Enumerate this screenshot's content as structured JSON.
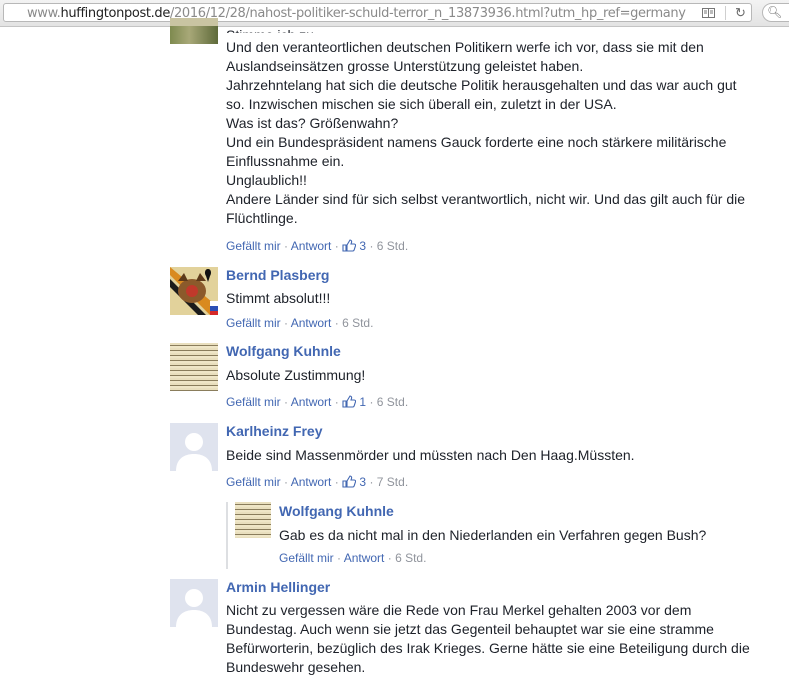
{
  "browser": {
    "url_prefix": "www.",
    "url_host": "huffingtonpost.de",
    "url_path": "/2016/12/28/nahost-politiker-schuld-terror_n_13873936.html?utm_hp_ref=germany",
    "icons": {
      "reader": "reader-view-icon",
      "reload": "reload-icon",
      "search": "search-icon"
    }
  },
  "comments": [
    {
      "id": "c1",
      "lines": [
        "Stimme ich zu.",
        "Und den veranteortlichen deutschen Politikern werfe ich vor, dass sie mit den",
        "Auslandseinsätzen grosse Unterstützung geleistet haben.",
        "Jahrzehntelang hat sich die deutsche Politik herausgehalten und das war auch gut",
        "so. Inzwischen mischen sie sich überall ein, zuletzt in der USA.",
        "Was ist das? Größenwahn?",
        "Und ein Bundespräsident namens Gauck forderte eine noch stärkere militärische",
        "Einflussnahme ein.",
        "Unglaublich!!",
        "Andere Länder sind für sich selbst verantwortlich, nicht wir. Und das gilt auch für die",
        "Flüchtlinge."
      ],
      "like_label": "Gefällt mir",
      "reply_label": "Antwort",
      "likes": "3",
      "time": "6 Std."
    },
    {
      "id": "c2",
      "name": "Bernd Plasberg",
      "text": "Stimmt absolut!!!",
      "like_label": "Gefällt mir",
      "reply_label": "Antwort",
      "time": "6 Std."
    },
    {
      "id": "c3",
      "name": "Wolfgang Kuhnle",
      "text": "Absolute Zustimmung!",
      "like_label": "Gefällt mir",
      "reply_label": "Antwort",
      "likes": "1",
      "time": "6 Std."
    },
    {
      "id": "c4",
      "name": "Karlheinz Frey",
      "text": "Beide sind Massenmörder und müssten nach Den Haag.Müssten.",
      "like_label": "Gefällt mir",
      "reply_label": "Antwort",
      "likes": "3",
      "time": "7 Std."
    },
    {
      "id": "c4r1",
      "name": "Wolfgang Kuhnle",
      "text": "Gab es da nicht mal in den Niederlanden ein Verfahren gegen Bush?",
      "like_label": "Gefällt mir",
      "reply_label": "Antwort",
      "time": "6 Std."
    },
    {
      "id": "c5",
      "name": "Armin Hellinger",
      "lines": [
        "Nicht zu vergessen wäre die Rede von Frau Merkel gehalten 2003 vor dem",
        "Bundestag. Auch wenn sie jetzt das Gegenteil behauptet war sie eine stramme",
        "Befürworterin, bezüglich des Irak Krieges. Gerne hätte sie eine Beteiligung durch die",
        "Bundeswehr gesehen."
      ]
    }
  ],
  "separator": "·",
  "colors": {
    "link": "#4267b2",
    "meta": "#90949c",
    "text": "#1d2129"
  }
}
